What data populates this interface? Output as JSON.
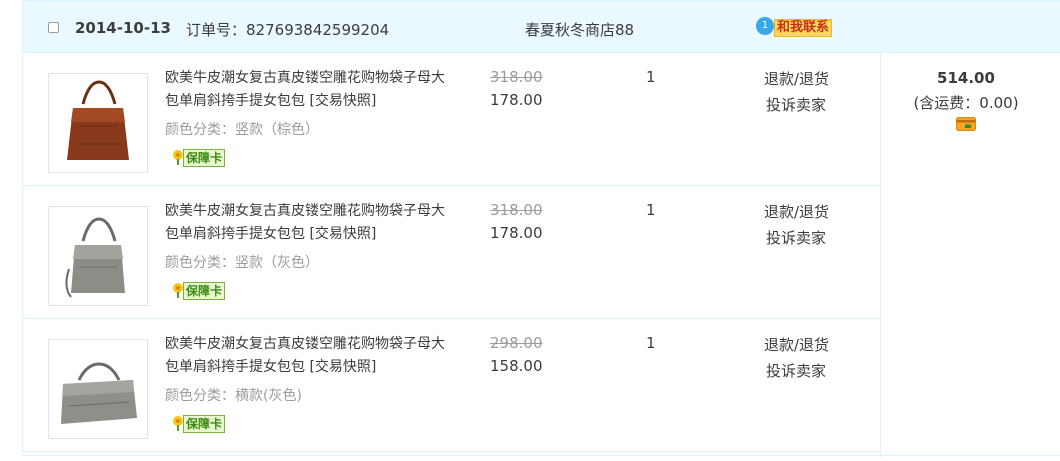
{
  "order": {
    "date": "2014-10-13",
    "order_label": "订单号：",
    "order_number": "827693842599204",
    "shop": "春夏秋冬商店88",
    "contact_label": "和我联系",
    "contact_badge": "1"
  },
  "items": [
    {
      "title": "欧美牛皮潮女复古真皮镂空雕花购物袋子母大包单肩斜挎手提女包包",
      "snapshot": "[交易快照]",
      "variant": "颜色分类：竖款（棕色）",
      "guarantee": "保障卡",
      "original_price": "318.00",
      "price": "178.00",
      "quantity": "1",
      "action1": "退款/退货",
      "action2": "投诉卖家",
      "thumb_icon": "brown-tote-bag"
    },
    {
      "title": "欧美牛皮潮女复古真皮镂空雕花购物袋子母大包单肩斜挎手提女包包",
      "snapshot": "[交易快照]",
      "variant": "颜色分类：竖款（灰色）",
      "guarantee": "保障卡",
      "original_price": "318.00",
      "price": "178.00",
      "quantity": "1",
      "action1": "退款/退货",
      "action2": "投诉卖家",
      "thumb_icon": "gray-tote-bag"
    },
    {
      "title": "欧美牛皮潮女复古真皮镂空雕花购物袋子母大包单肩斜挎手提女包包",
      "snapshot": "[交易快照]",
      "variant": "颜色分类：横款(灰色)",
      "guarantee": "保障卡",
      "original_price": "298.00",
      "price": "158.00",
      "quantity": "1",
      "action1": "退款/退货",
      "action2": "投诉卖家",
      "thumb_icon": "gray-wide-bag"
    }
  ],
  "summary": {
    "total": "514.00",
    "shipping": "(含运费：0.00)",
    "card_icon": "credit-card-icon"
  },
  "colors": {
    "header_bg": "#eaf8ff",
    "border": "#daf3ff",
    "contact_bg": "#ffd85c",
    "guarantee_green": "#3e8b12"
  }
}
